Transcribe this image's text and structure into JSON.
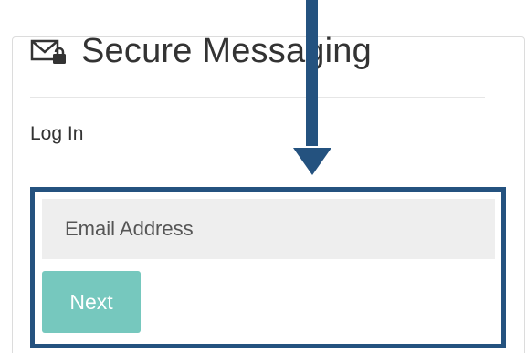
{
  "panel": {
    "title": "Secure Messaging",
    "title_icon": "envelope-lock-icon"
  },
  "login": {
    "heading": "Log In",
    "email_placeholder": "Email Address",
    "email_value": "",
    "next_label": "Next"
  },
  "annotation": {
    "highlight_color": "#24527f",
    "arrow_icon": "arrow-down-icon"
  },
  "colors": {
    "button": "#76c8be",
    "input_bg": "#eeeeee",
    "text": "#333333"
  }
}
